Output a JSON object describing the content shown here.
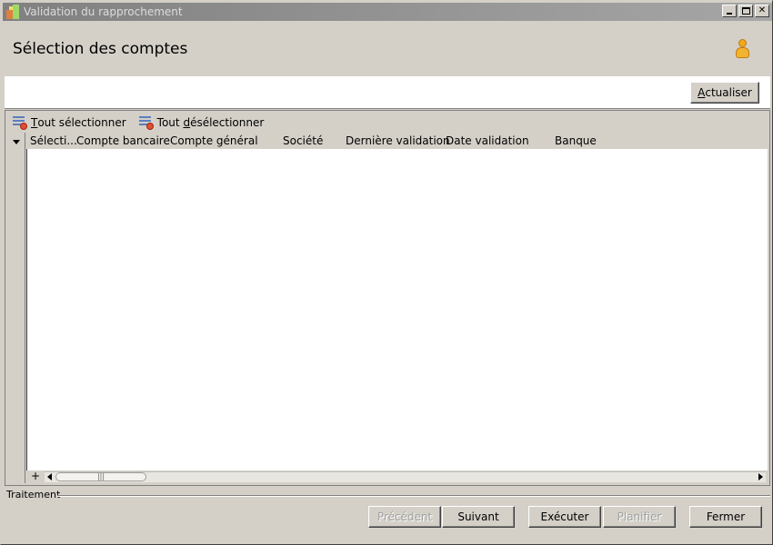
{
  "window": {
    "title": "Validation du rapprochement"
  },
  "header": {
    "page_title": "Sélection des comptes"
  },
  "actions": {
    "refresh_label": "Actualiser",
    "refresh_mnemonic": "A",
    "refresh_rest": "ctualiser"
  },
  "grid_toolbar": {
    "select_all_mnemonic": "T",
    "select_all_rest": "out sélectionner",
    "deselect_all_prefix": "Tout ",
    "deselect_all_mnemonic": "d",
    "deselect_all_rest": "ésélectionner"
  },
  "grid": {
    "columns": [
      "Sélecti...",
      "Compte bancaire",
      "Compte général",
      "Société",
      "Dernière validation",
      "Date validation",
      "Banque"
    ],
    "rows": [],
    "add_glyph": "+",
    "thumb_grip": "|||"
  },
  "footer": {
    "section_label": "Traitement",
    "buttons": {
      "previous": "Précédent",
      "next": "Suivant",
      "execute": "Exécuter",
      "schedule": "Planifier",
      "close": "Fermer"
    }
  }
}
